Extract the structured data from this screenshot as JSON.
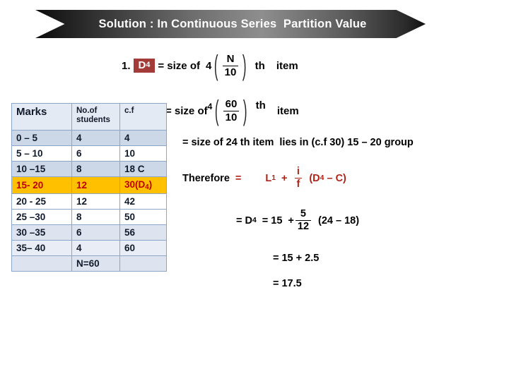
{
  "banner": {
    "title": "Solution : In Continuous Series  Partition Value"
  },
  "line1": {
    "index": "1.",
    "badge": "D",
    "badge_sub": "4",
    "eq": "= size of",
    "coef": "4",
    "num": "N",
    "den": "10",
    "th": "th",
    "item": "item"
  },
  "line2": {
    "eq": "= size of",
    "coef": "4",
    "num": "60",
    "den": "10",
    "th": "th",
    "item": "item"
  },
  "line3": {
    "text": "= size of 24 th item  lies in (c.f 30) 15 – 20 group"
  },
  "line4": {
    "therefore": "Therefore",
    "equals": "=",
    "L": "L",
    "L_sub": "1",
    "plus": "+",
    "num": "i",
    "den": "f",
    "tail_open": "(D",
    "tail_sub": "4",
    "tail_close": " – C)"
  },
  "line5": {
    "eq1": "= D",
    "eq1_sub": "4",
    "eq2": "= 15",
    "plus": "+",
    "num": "5",
    "den": "12",
    "tail": "(24 – 18)"
  },
  "line6": {
    "text": "= 15 + 2.5"
  },
  "line7": {
    "text": "= 17.5"
  },
  "table": {
    "headers": [
      "Marks",
      "No.of\nstudents",
      "c.f"
    ],
    "header_marks": "Marks",
    "header_students": "No.of students",
    "header_cf": "c.f",
    "rows": [
      {
        "marks": "0 – 5",
        "students": "4",
        "cf": "4"
      },
      {
        "marks": "5 – 10",
        "students": "6",
        "cf": "10"
      },
      {
        "marks": "10 –15",
        "students": "8",
        "cf": "18 C"
      },
      {
        "marks": "15- 20",
        "students": "12",
        "cf": "30(D4)"
      },
      {
        "marks": "20 - 25",
        "students": "12",
        "cf": "42"
      },
      {
        "marks": "25 –30",
        "students": "8",
        "cf": "50"
      },
      {
        "marks": "30 –35",
        "students": "6",
        "cf": "56"
      },
      {
        "marks": "35– 40",
        "students": "4",
        "cf": "60"
      }
    ],
    "highlight_row_index": 3,
    "total_row": {
      "marks": "",
      "students": "N=60",
      "cf": ""
    },
    "cf_highlight_main": "30(D",
    "cf_highlight_sub": "4",
    "cf_highlight_close": ")"
  },
  "colors": {
    "highlight_bg": "#ffc000",
    "highlight_text": "#c00000",
    "badge_bg": "#a33b38",
    "formula_red": "#b02418",
    "table_border": "#8ba6c6",
    "header_bg": "#e4eaf3"
  }
}
